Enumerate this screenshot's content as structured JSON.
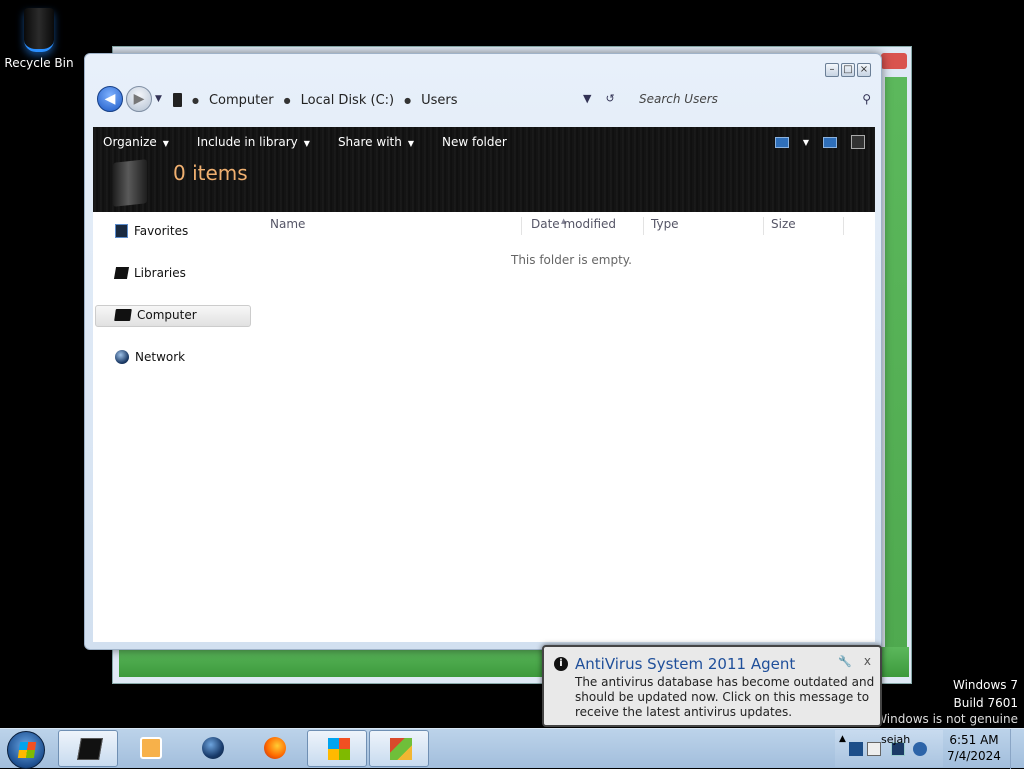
{
  "desktop": {
    "recycle_bin_label": "Recycle Bin"
  },
  "window": {
    "breadcrumb": [
      "Computer",
      "Local Disk (C:)",
      "Users"
    ],
    "search_placeholder": "Search Users",
    "toolbar": {
      "organize": "Organize",
      "include_in_library": "Include in library",
      "share_with": "Share with",
      "new_folder": "New folder"
    },
    "header_items": "0 items",
    "nav_pane": [
      "Favorites",
      "Libraries",
      "Computer",
      "Network"
    ],
    "selected_nav": "Computer",
    "columns": [
      "Name",
      "Date modified",
      "Type",
      "Size"
    ],
    "empty_message": "This folder is empty."
  },
  "notification": {
    "title": "AntiVirus System 2011 Agent",
    "message": "The antivirus database has become outdated and should be updated now. Click on this message to receive the latest antivirus updates.",
    "close_glyph": "x"
  },
  "watermark": {
    "line1": "Windows 7",
    "line2": "Build 7601",
    "line3": "This copy of Windows is not genuine"
  },
  "taskbar": {
    "clock_time": "6:51 AM",
    "clock_date": "7/4/2024",
    "tray_partial_text": "sejah",
    "icons": [
      "explorer-icon",
      "media-player-icon",
      "browser-icon",
      "firefox-icon",
      "windows-logo-icon",
      "colorful-app-icon"
    ]
  }
}
